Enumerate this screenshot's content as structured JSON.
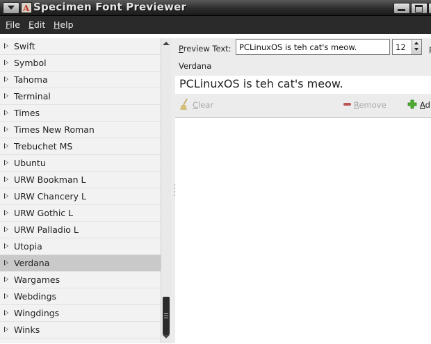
{
  "window": {
    "title": "Specimen Font Previewer",
    "menu_button_icon": "window-menu-icon",
    "app_icon": "specimen-app-icon"
  },
  "menu": {
    "file": {
      "accel": "F",
      "rest": "ile"
    },
    "edit": {
      "accel": "E",
      "rest": "dit"
    },
    "help": {
      "accel": "H",
      "rest": "elp"
    }
  },
  "font_list": [
    {
      "name": "Swift",
      "selected": false
    },
    {
      "name": "Symbol",
      "selected": false
    },
    {
      "name": "Tahoma",
      "selected": false
    },
    {
      "name": "Terminal",
      "selected": false
    },
    {
      "name": "Times",
      "selected": false
    },
    {
      "name": "Times New Roman",
      "selected": false
    },
    {
      "name": "Trebuchet MS",
      "selected": false
    },
    {
      "name": "Ubuntu",
      "selected": false
    },
    {
      "name": "URW Bookman L",
      "selected": false
    },
    {
      "name": "URW Chancery L",
      "selected": false
    },
    {
      "name": "URW Gothic L",
      "selected": false
    },
    {
      "name": "URW Palladio L",
      "selected": false
    },
    {
      "name": "Utopia",
      "selected": false
    },
    {
      "name": "Verdana",
      "selected": true
    },
    {
      "name": "Wargames",
      "selected": false
    },
    {
      "name": "Webdings",
      "selected": false
    },
    {
      "name": "Wingdings",
      "selected": false
    },
    {
      "name": "Winks",
      "selected": false
    }
  ],
  "preview": {
    "label_accel": "P",
    "label_rest": "review Text:",
    "text_value": "PCLinuxOS is teh cat's meow.",
    "size_value": "12",
    "size_unit": "p",
    "current_font": "Verdana",
    "sample_text": "PCLinuxOS is teh cat's meow."
  },
  "actions": {
    "clear": {
      "accel": "C",
      "rest": "lear"
    },
    "remove": {
      "accel": "R",
      "rest": "emove"
    },
    "add": {
      "accel": "A",
      "rest": "d"
    }
  },
  "colors": {
    "selection": "#c9c9c9",
    "title_bar": "#2c2c2c",
    "menu_bar": "#2a2a2a",
    "add_icon": "#4caf2e",
    "remove_icon": "#bb5555"
  }
}
